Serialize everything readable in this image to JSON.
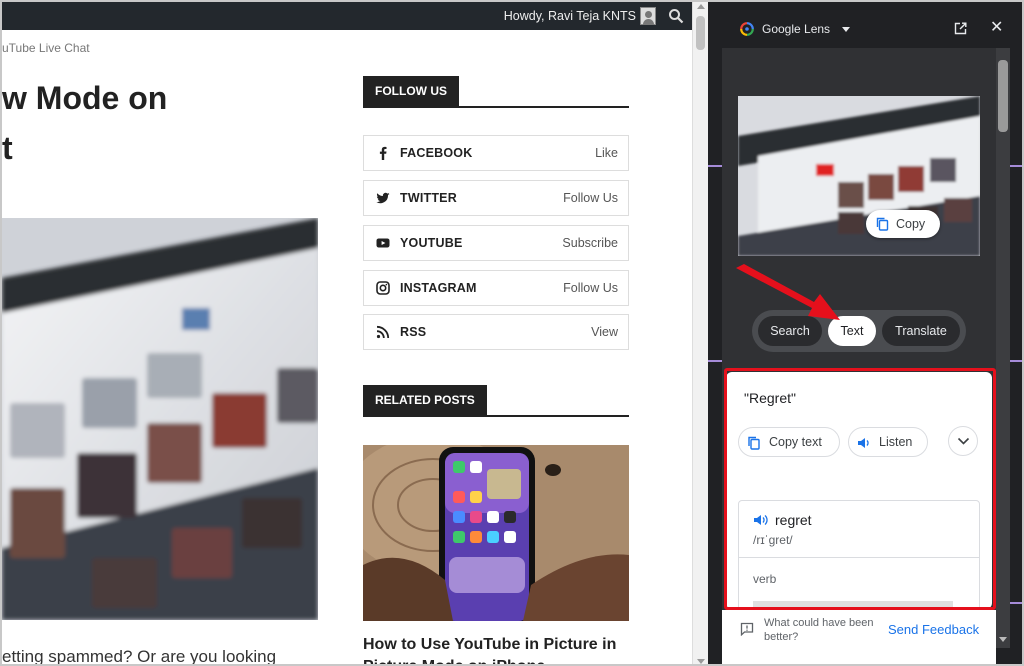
{
  "admin_bar": {
    "greeting": "Howdy, Ravi Teja KNTS"
  },
  "article": {
    "breadcrumb": "uTube Live Chat",
    "title_line1": "w Mode on",
    "title_line2": "t",
    "excerpt": "etting spammed? Or are you looking"
  },
  "sidebar": {
    "follow_heading": "FOLLOW US",
    "social": [
      {
        "icon": "facebook-icon",
        "name": "FACEBOOK",
        "action": "Like"
      },
      {
        "icon": "twitter-icon",
        "name": "TWITTER",
        "action": "Follow Us"
      },
      {
        "icon": "youtube-icon",
        "name": "YOUTUBE",
        "action": "Subscribe"
      },
      {
        "icon": "instagram-icon",
        "name": "INSTAGRAM",
        "action": "Follow Us"
      },
      {
        "icon": "rss-icon",
        "name": "RSS",
        "action": "View"
      }
    ],
    "related_heading": "RELATED POSTS",
    "related_post_title": "How to Use YouTube in Picture in Picture Mode on iPhone"
  },
  "lens": {
    "title": "Google Lens",
    "copy_chip": "Copy",
    "modes": [
      "Search",
      "Text",
      "Translate"
    ],
    "active_mode": "Text",
    "result": {
      "quote": "\"Regret\"",
      "copy_text": "Copy text",
      "listen": "Listen",
      "word": "regret",
      "ipa": "/rɪˈɡret/",
      "part_of_speech": "verb"
    },
    "feedback": {
      "question": "What could have been better?",
      "send": "Send Feedback"
    },
    "accent_color": "#1a73e8",
    "highlight_color": "#e5101c"
  }
}
